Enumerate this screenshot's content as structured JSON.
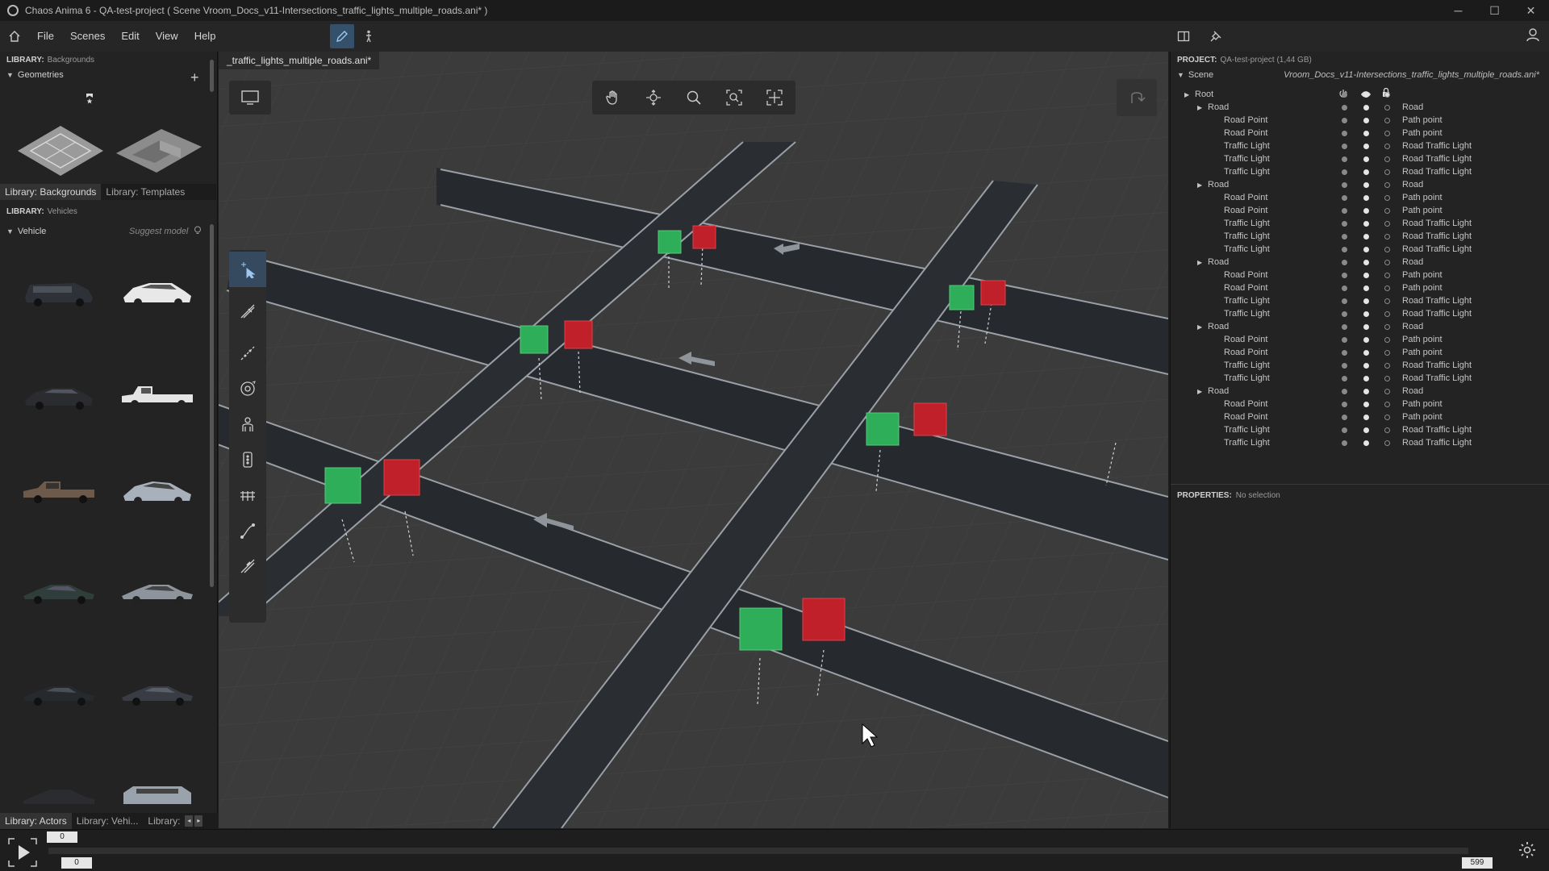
{
  "window": {
    "title": "Chaos Anima 6 -  QA-test-project ( Scene Vroom_Docs_v11-Intersections_traffic_lights_multiple_roads.ani* )",
    "controls": [
      "─",
      "☐",
      "✕"
    ]
  },
  "menu": {
    "items": [
      "File",
      "Scenes",
      "Edit",
      "View",
      "Help"
    ]
  },
  "left_panel": {
    "backgrounds_header": {
      "label": "LIBRARY:",
      "value": "Backgrounds"
    },
    "geometries_section": "Geometries",
    "library_tabs": [
      "Library: Backgrounds",
      "Library: Templates"
    ],
    "vehicles_header": {
      "label": "LIBRARY:",
      "value": "Vehicles"
    },
    "vehicle_section": "Vehicle",
    "suggest_model": "Suggest model",
    "bottom_tabs": [
      "Library: Actors",
      "Library: Vehi...",
      "Library:"
    ]
  },
  "viewport": {
    "doc_tab": "_traffic_lights_multiple_roads.ani*",
    "nav_tools": [
      "pan-hand-icon",
      "orbit-icon",
      "zoom-icon",
      "zoom-fit-icon",
      "frame-all-icon"
    ],
    "side_tools": [
      "select-move-icon",
      "draw-road-icon",
      "draw-path-icon",
      "orbit-camera-icon",
      "crowd-actor-icon",
      "traffic-light-icon",
      "fence-icon",
      "rail-curve-icon",
      "edit-path-icon"
    ]
  },
  "right_panel": {
    "project_header": {
      "label": "PROJECT:",
      "value": "QA-test-project (1,44 GB)"
    },
    "scene_label": "Scene",
    "scene_file": "Vroom_Docs_v11-Intersections_traffic_lights_multiple_roads.ani*",
    "tree": [
      {
        "name": "Root",
        "type": "",
        "level": 0,
        "expand": true
      },
      {
        "name": "Road",
        "type": "Road",
        "level": 1,
        "expand": true
      },
      {
        "name": "Road Point",
        "type": "Path point",
        "level": 2
      },
      {
        "name": "Road Point",
        "type": "Path point",
        "level": 2
      },
      {
        "name": "Traffic Light",
        "type": "Road Traffic Light",
        "level": 2
      },
      {
        "name": "Traffic Light",
        "type": "Road Traffic Light",
        "level": 2
      },
      {
        "name": "Traffic Light",
        "type": "Road Traffic Light",
        "level": 2
      },
      {
        "name": "Road",
        "type": "Road",
        "level": 1,
        "expand": true
      },
      {
        "name": "Road Point",
        "type": "Path point",
        "level": 2
      },
      {
        "name": "Road Point",
        "type": "Path point",
        "level": 2
      },
      {
        "name": "Traffic Light",
        "type": "Road Traffic Light",
        "level": 2
      },
      {
        "name": "Traffic Light",
        "type": "Road Traffic Light",
        "level": 2
      },
      {
        "name": "Traffic Light",
        "type": "Road Traffic Light",
        "level": 2
      },
      {
        "name": "Road",
        "type": "Road",
        "level": 1,
        "expand": true
      },
      {
        "name": "Road Point",
        "type": "Path point",
        "level": 2
      },
      {
        "name": "Road Point",
        "type": "Path point",
        "level": 2
      },
      {
        "name": "Traffic Light",
        "type": "Road Traffic Light",
        "level": 2
      },
      {
        "name": "Traffic Light",
        "type": "Road Traffic Light",
        "level": 2
      },
      {
        "name": "Road",
        "type": "Road",
        "level": 1,
        "expand": true
      },
      {
        "name": "Road Point",
        "type": "Path point",
        "level": 2
      },
      {
        "name": "Road Point",
        "type": "Path point",
        "level": 2
      },
      {
        "name": "Traffic Light",
        "type": "Road Traffic Light",
        "level": 2
      },
      {
        "name": "Traffic Light",
        "type": "Road Traffic Light",
        "level": 2
      },
      {
        "name": "Road",
        "type": "Road",
        "level": 1,
        "expand": true
      },
      {
        "name": "Road Point",
        "type": "Path point",
        "level": 2
      },
      {
        "name": "Road Point",
        "type": "Path point",
        "level": 2
      },
      {
        "name": "Traffic Light",
        "type": "Road Traffic Light",
        "level": 2
      },
      {
        "name": "Traffic Light",
        "type": "Road Traffic Light",
        "level": 2
      }
    ],
    "properties": {
      "label": "PROPERTIES:",
      "value": "No selection"
    }
  },
  "timeline": {
    "current_frame": "0",
    "start_frame": "0",
    "end_frame": "599"
  },
  "colors": {
    "accent": "#34506a",
    "light_green": "#2fae5a",
    "light_red": "#c0202a"
  }
}
